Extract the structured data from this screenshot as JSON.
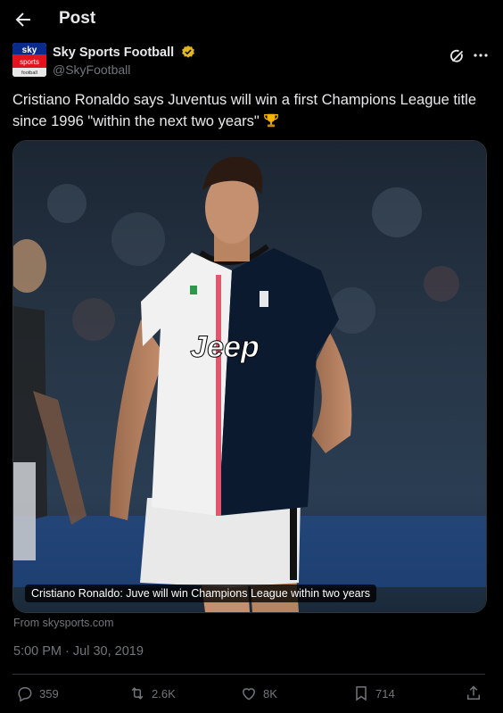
{
  "header": {
    "title": "Post",
    "back_icon": "arrow-left-icon"
  },
  "author": {
    "name": "Sky Sports Football",
    "handle": "@SkyFootball",
    "avatar_lines": [
      "sky",
      "sports",
      "football"
    ],
    "verified_color": "#e2b719"
  },
  "post": {
    "text": "Cristiano Ronaldo says Juventus will win a first Champions League title since 1996 \"within the next two years\"",
    "emoji_icon": "trophy-icon"
  },
  "card": {
    "image_text": "Jeep",
    "caption": "Cristiano Ronaldo: Juve will win Champions League within two years",
    "source": "From skysports.com"
  },
  "timestamp": "5:00 PM · Jul 30, 2019",
  "actions": {
    "replies": "359",
    "reposts": "2.6K",
    "likes": "8K",
    "bookmarks": "714"
  },
  "colors": {
    "background": "#000000",
    "text": "#e7e9ea",
    "muted": "#71767b",
    "border": "#2f3336"
  }
}
